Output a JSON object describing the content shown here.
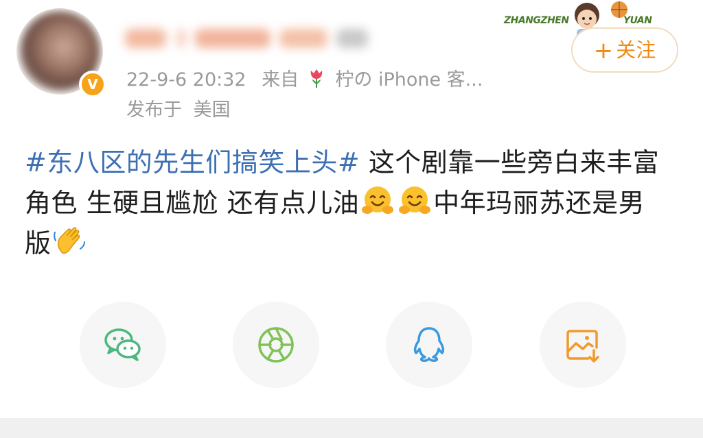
{
  "post": {
    "timestamp": "22-9-6 20:32",
    "source_prefix": "来自",
    "source_device": "柠の iPhone 客...",
    "location_prefix": "发布于",
    "location": "美国",
    "hashtag": "#东八区的先生们搞笑上头#",
    "text_part1": " 这个剧靠一些旁白来丰富角色 生硬且尴尬 还有点儿油",
    "text_part2": "中年玛丽苏还是男版"
  },
  "header": {
    "follow_label": "关注",
    "sticker_text_left": "ZHANGZHEN",
    "sticker_text_right": "YUAN"
  },
  "share": {
    "items": [
      {
        "name": "wechat",
        "color": "#4bb880"
      },
      {
        "name": "moments",
        "color": "#7fc256"
      },
      {
        "name": "qq",
        "color": "#3a9ae0"
      },
      {
        "name": "save-image",
        "color": "#f09a2c"
      }
    ]
  },
  "colors": {
    "hashtag": "#3d6fb3",
    "meta_gray": "#9a9a9a",
    "follow_orange": "#f08a16",
    "verified_badge": "#f7a21b"
  }
}
